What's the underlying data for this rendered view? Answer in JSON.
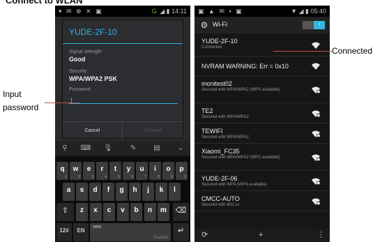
{
  "heading": "Connect to WLAN",
  "status_left": {
    "icons": "▾ ✉ ⊕ ✕ ▣",
    "signal": "G",
    "time": "14:11"
  },
  "status_right": {
    "icons": "▣ ▲ ✉ ▪ ▣",
    "time": "05:40"
  },
  "dialog": {
    "title": "YUDE-2F-10",
    "signal_label": "Signal strength",
    "signal_value": "Good",
    "security_label": "Security",
    "security_value": "WPA/WPA2 PSK",
    "password_label": "Password",
    "cancel_label": "Cancel",
    "connect_label": "Connect"
  },
  "keyboard": {
    "tools": [
      "⚲",
      "⌨",
      "🎙",
      "✎",
      "▤",
      "⌄"
    ],
    "row1": [
      {
        "k": "q",
        "n": "1"
      },
      {
        "k": "w",
        "n": "2"
      },
      {
        "k": "e",
        "n": "3"
      },
      {
        "k": "r",
        "n": "4"
      },
      {
        "k": "t",
        "n": "5"
      },
      {
        "k": "y",
        "n": "6"
      },
      {
        "k": "u",
        "n": "7"
      },
      {
        "k": "i",
        "n": "8"
      },
      {
        "k": "o",
        "n": "9"
      },
      {
        "k": "p",
        "n": "0"
      }
    ],
    "row2": [
      "a",
      "s",
      "d",
      "f",
      "g",
      "h",
      "j",
      "k",
      "l"
    ],
    "row3": [
      "z",
      "x",
      "c",
      "v",
      "b",
      "n",
      "m"
    ],
    "shift": "⇧",
    "backspace": "⌫",
    "mode_key": "12#",
    "lang_key": "EN",
    "space_label": "TouchPal",
    "enter_key": "↵"
  },
  "wifi": {
    "title": "Wi-Fi",
    "toggle_label": "I",
    "networks": [
      {
        "name": "YUDE-2F-10",
        "status": "Connected"
      },
      {
        "name": "NVRAM WARNING: Err = 0x10",
        "status": ""
      },
      {
        "name": "monitest02",
        "status": "Secured with WPA/WPA2 (WPS available)"
      },
      {
        "name": "TE2",
        "status": "Secured with WPA/WPA2"
      },
      {
        "name": "TEWIFI",
        "status": "Secured with WPA/WPA2"
      },
      {
        "name": "Xiaomi_FC35",
        "status": "Secured with WPA/WPA2 (WPS available)"
      },
      {
        "name": "YUDE-2F-06",
        "status": "Secured with WPA (WPS available)"
      },
      {
        "name": "CMCC-AUTO",
        "status": "Secured with 802.1x"
      }
    ],
    "bottom_icons": {
      "scan": "⟳",
      "add": "+",
      "menu": "⋮"
    }
  },
  "annotations": {
    "input_password": [
      "Input",
      "password"
    ],
    "connected": "Connected"
  },
  "colors": {
    "accent": "#33b5e5",
    "annotation_line": "#c0504d",
    "signal_green": "#6fbf2a"
  }
}
